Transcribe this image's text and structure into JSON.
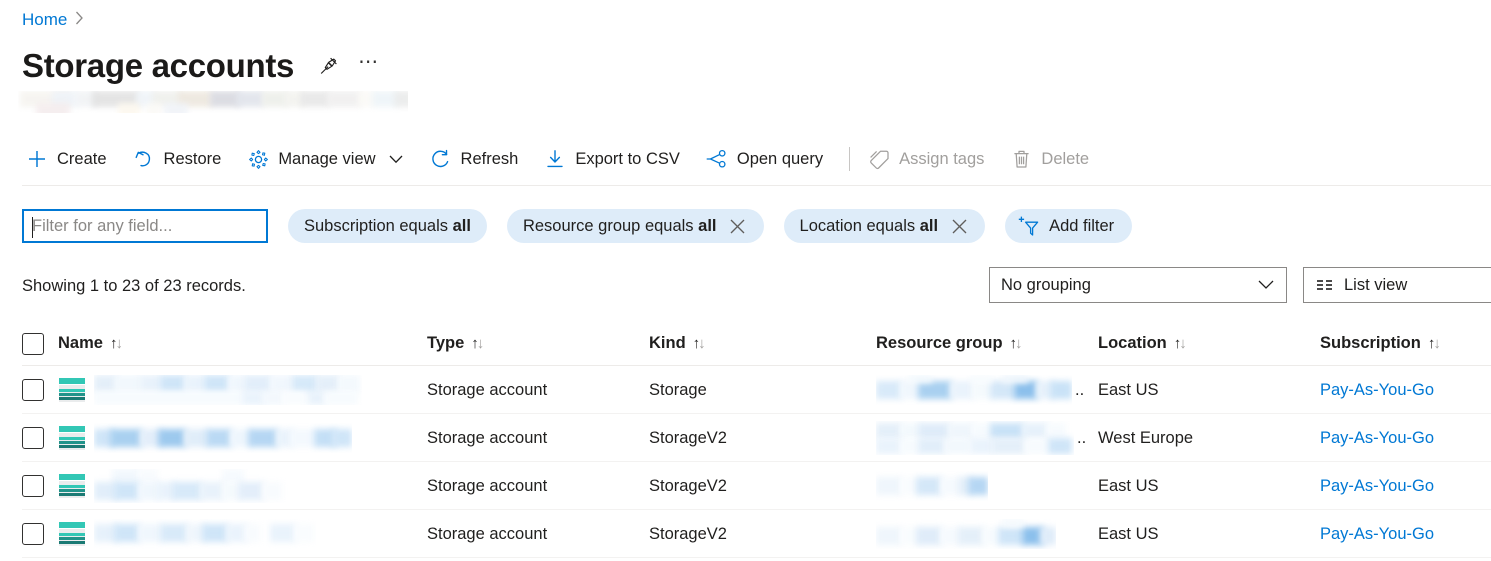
{
  "breadcrumb": {
    "home_label": "Home",
    "separator": "›"
  },
  "header": {
    "title": "Storage accounts",
    "pin_icon": "pin-icon",
    "more_icon": "ellipsis-icon",
    "subtitle_redacted": true
  },
  "toolbar": {
    "items": [
      {
        "label": "Create",
        "icon": "plus-icon",
        "enabled": true
      },
      {
        "label": "Restore",
        "icon": "restore-icon",
        "enabled": true
      },
      {
        "label": "Manage view",
        "icon": "gear-icon",
        "enabled": true,
        "has_chevron": true
      },
      {
        "label": "Refresh",
        "icon": "refresh-icon",
        "enabled": true
      },
      {
        "label": "Export to CSV",
        "icon": "download-icon",
        "enabled": true
      },
      {
        "label": "Open query",
        "icon": "query-graph-icon",
        "enabled": true
      },
      {
        "label": "Assign tags",
        "icon": "tag-icon",
        "enabled": false
      },
      {
        "label": "Delete",
        "icon": "trash-icon",
        "enabled": false
      }
    ]
  },
  "filters": {
    "search": {
      "value": "",
      "placeholder": "Filter for any field..."
    },
    "pills": [
      {
        "prefix": "Subscription equals ",
        "value": "all",
        "dismissible": false
      },
      {
        "prefix": "Resource group equals ",
        "value": "all",
        "dismissible": true
      },
      {
        "prefix": "Location equals ",
        "value": "all",
        "dismissible": true
      }
    ],
    "add_filter": {
      "label": "Add filter",
      "icon": "add-filter-icon"
    }
  },
  "summary": {
    "records_text": "Showing 1 to 23 of 23 records.",
    "grouping": {
      "selected": "No grouping",
      "chevron": "chevron-down-icon"
    },
    "view_toggle": {
      "label": "List view",
      "icon": "list-view-icon"
    }
  },
  "table": {
    "select_all_checkbox": false,
    "columns": [
      {
        "label": "Name",
        "sortable": true
      },
      {
        "label": "Type",
        "sortable": true
      },
      {
        "label": "Kind",
        "sortable": true
      },
      {
        "label": "Resource group",
        "sortable": true
      },
      {
        "label": "Location",
        "sortable": true
      },
      {
        "label": "Subscription",
        "sortable": true
      }
    ],
    "rows": [
      {
        "checked": false,
        "icon": "storage-account-icon",
        "name_redacted": true,
        "type": "Storage account",
        "kind": "Storage",
        "resource_group_redacted": true,
        "resource_group_truncated": "..",
        "location": "East US",
        "subscription": "Pay-As-You-Go"
      },
      {
        "checked": false,
        "icon": "storage-account-icon",
        "name_redacted": true,
        "type": "Storage account",
        "kind": "StorageV2",
        "resource_group_redacted": true,
        "resource_group_truncated": "..",
        "location": "West Europe",
        "subscription": "Pay-As-You-Go"
      },
      {
        "checked": false,
        "icon": "storage-account-icon",
        "name_redacted": true,
        "type": "Storage account",
        "kind": "StorageV2",
        "resource_group_redacted": true,
        "resource_group_truncated": "",
        "location": "East US",
        "subscription": "Pay-As-You-Go"
      },
      {
        "checked": false,
        "icon": "storage-account-icon",
        "name_redacted": true,
        "type": "Storage account",
        "kind": "StorageV2",
        "resource_group_redacted": true,
        "resource_group_truncated": "",
        "location": "East US",
        "subscription": "Pay-As-You-Go"
      }
    ]
  },
  "colors": {
    "accent": "#0078d4",
    "link": "#0078d4",
    "pill_bg": "#deecf9",
    "storage_icon_teal": "#32c7b5",
    "text": "#201f1e",
    "disabled_text": "#a19f9d",
    "border": "#8a8886",
    "row_divider": "#f3f2f1"
  }
}
